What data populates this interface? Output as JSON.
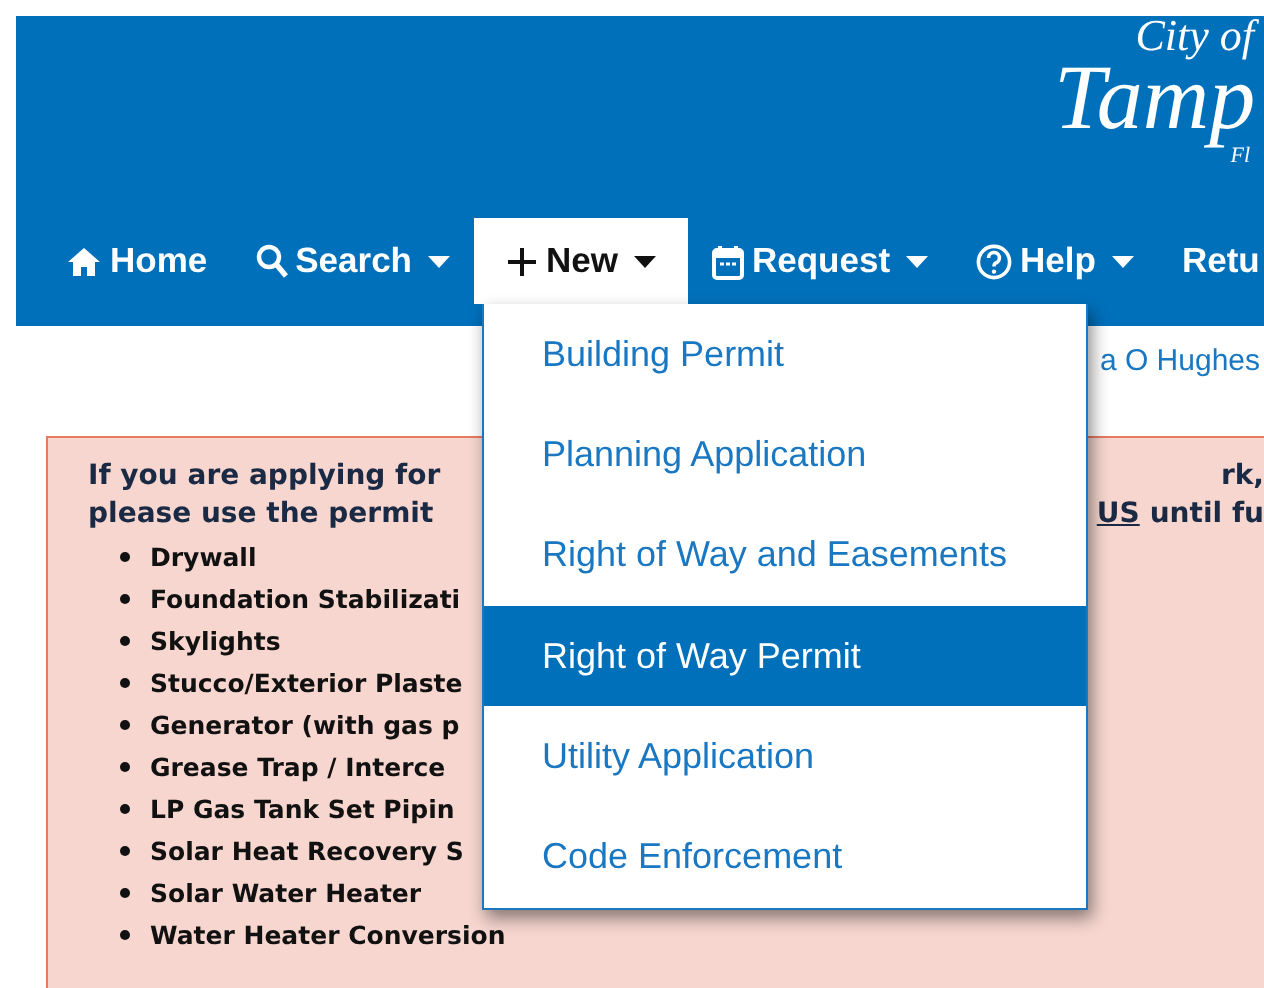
{
  "logo": {
    "line_1": "City of",
    "line_2": "Tamp",
    "line_3": "Fl"
  },
  "nav": [
    {
      "kind": "home",
      "label": "Home",
      "has_caret": false,
      "selected": false
    },
    {
      "kind": "search",
      "label": "Search",
      "has_caret": true,
      "selected": false
    },
    {
      "kind": "plus",
      "label": "New",
      "has_caret": true,
      "selected": true
    },
    {
      "kind": "calendar",
      "label": "Request",
      "has_caret": true,
      "selected": false
    },
    {
      "kind": "help",
      "label": "Help",
      "has_caret": true,
      "selected": false
    },
    {
      "kind": "none",
      "label": "Retu",
      "has_caret": false,
      "selected": false
    }
  ],
  "user_name": "a O Hughes",
  "notice": {
    "line_1_start": "If you are applying for",
    "line_1_end": "rk,",
    "line_2_start": "please use the permit",
    "line_2_link": "US",
    "line_2_end": "until fu",
    "items": [
      "Drywall",
      "Foundation Stabilizati",
      "Skylights",
      "Stucco/Exterior Plaste",
      "Generator (with gas p",
      "Grease Trap / Interce",
      "LP Gas Tank Set Pipin",
      "Solar Heat Recovery S",
      "Solar Water Heater",
      "Water Heater Conversion"
    ]
  },
  "menu": {
    "items": [
      {
        "label": "Building Permit",
        "selected": false
      },
      {
        "label": "Planning Application",
        "selected": false
      },
      {
        "label": "Right of Way and Easements",
        "selected": false
      },
      {
        "label": "Right of Way Permit",
        "selected": true
      },
      {
        "label": "Utility Application",
        "selected": false
      },
      {
        "label": "Code Enforcement",
        "selected": false
      }
    ]
  }
}
